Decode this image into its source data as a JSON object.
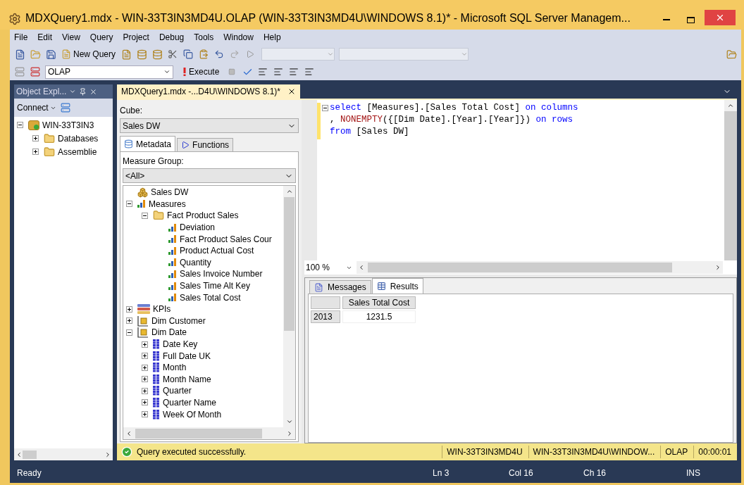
{
  "window": {
    "title": "MDXQuery1.mdx - WIN-33T3IN3MD4U.OLAP (WIN-33T3IN3MD4U\\WINDOWS 8.1)* - Microsoft SQL Server Managem..."
  },
  "menu": [
    "File",
    "Edit",
    "View",
    "Query",
    "Project",
    "Debug",
    "Tools",
    "Window",
    "Help"
  ],
  "toolbar": {
    "new_query": "New Query",
    "database": "OLAP",
    "execute": "Execute"
  },
  "object_explorer": {
    "title": "Object Expl...",
    "connect": "Connect",
    "tree": [
      {
        "label": "WIN-33T3IN3",
        "kind": "server",
        "expanded": true,
        "children": [
          {
            "label": "Databases",
            "kind": "folder",
            "expanded": false
          },
          {
            "label": "Assemblie",
            "kind": "folder",
            "expanded": false
          }
        ]
      }
    ]
  },
  "editor_tab": {
    "label": "MDXQuery1.mdx -...D4U\\WINDOWS 8.1)*",
    "selected": true
  },
  "metadata": {
    "cube_label": "Cube:",
    "cube": "Sales DW",
    "tabs": [
      {
        "label": "Metadata",
        "selected": true
      },
      {
        "label": "Functions",
        "selected": false
      }
    ],
    "measure_group_label": "Measure Group:",
    "measure_group": "<All>",
    "tree": [
      {
        "label": "Sales DW",
        "kind": "cube",
        "children": [
          {
            "label": "Measures",
            "kind": "measures",
            "expanded": true,
            "children": [
              {
                "label": "Fact Product Sales",
                "kind": "folder",
                "expanded": true,
                "children": [
                  {
                    "label": "Deviation",
                    "kind": "measure"
                  },
                  {
                    "label": "Fact Product Sales Cour",
                    "kind": "measure"
                  },
                  {
                    "label": "Product Actual Cost",
                    "kind": "measure"
                  },
                  {
                    "label": "Quantity",
                    "kind": "measure"
                  },
                  {
                    "label": "Sales Invoice Number",
                    "kind": "measure"
                  },
                  {
                    "label": "Sales Time Alt Key",
                    "kind": "measure"
                  },
                  {
                    "label": "Sales Total Cost",
                    "kind": "measure"
                  }
                ]
              }
            ]
          },
          {
            "label": "KPIs",
            "kind": "kpis",
            "expanded": false
          },
          {
            "label": "Dim Customer",
            "kind": "dimension",
            "expanded": false
          },
          {
            "label": "Dim Date",
            "kind": "dimension",
            "expanded": true,
            "children": [
              {
                "label": "Date Key",
                "kind": "attribute",
                "expanded": false
              },
              {
                "label": "Full Date UK",
                "kind": "attribute",
                "expanded": false
              },
              {
                "label": "Month",
                "kind": "attribute",
                "expanded": false
              },
              {
                "label": "Month Name",
                "kind": "attribute",
                "expanded": false
              },
              {
                "label": "Quarter",
                "kind": "attribute",
                "expanded": false
              },
              {
                "label": "Quarter Name",
                "kind": "attribute",
                "expanded": false
              },
              {
                "label": "Week Of Month",
                "kind": "attribute",
                "expanded": false
              }
            ]
          }
        ]
      }
    ]
  },
  "code": [
    [
      {
        "text": "select",
        "kind": "keyword"
      },
      {
        "text": " [Measures].[Sales Total Cost] ",
        "kind": "plain"
      },
      {
        "text": "on columns",
        "kind": "keyword"
      }
    ],
    [
      {
        "text": ", ",
        "kind": "plain"
      },
      {
        "text": "NONEMPTY",
        "kind": "function"
      },
      {
        "text": "({[Dim Date].[Year].[Year]}) ",
        "kind": "plain"
      },
      {
        "text": "on rows",
        "kind": "keyword"
      }
    ],
    [
      {
        "text": "from",
        "kind": "keyword"
      },
      {
        "text": " [Sales DW]",
        "kind": "plain"
      }
    ]
  ],
  "zoom": "100 %",
  "results": {
    "tabs": [
      {
        "label": "Messages",
        "selected": false
      },
      {
        "label": "Results",
        "selected": true
      }
    ],
    "columns": [
      "Sales Total Cost"
    ],
    "rows": [
      {
        "header": "2013",
        "cells": [
          "1231.5"
        ]
      }
    ]
  },
  "query_status": {
    "message": "Query executed successfully.",
    "fields": [
      "WIN-33T3IN3MD4U",
      "WIN-33T3IN3MD4U\\WINDOW...",
      "OLAP",
      "00:00:01"
    ]
  },
  "status_bar": {
    "state": "Ready",
    "line": "Ln 3",
    "col": "Col 16",
    "ch": "Ch 16",
    "mode": "INS"
  }
}
